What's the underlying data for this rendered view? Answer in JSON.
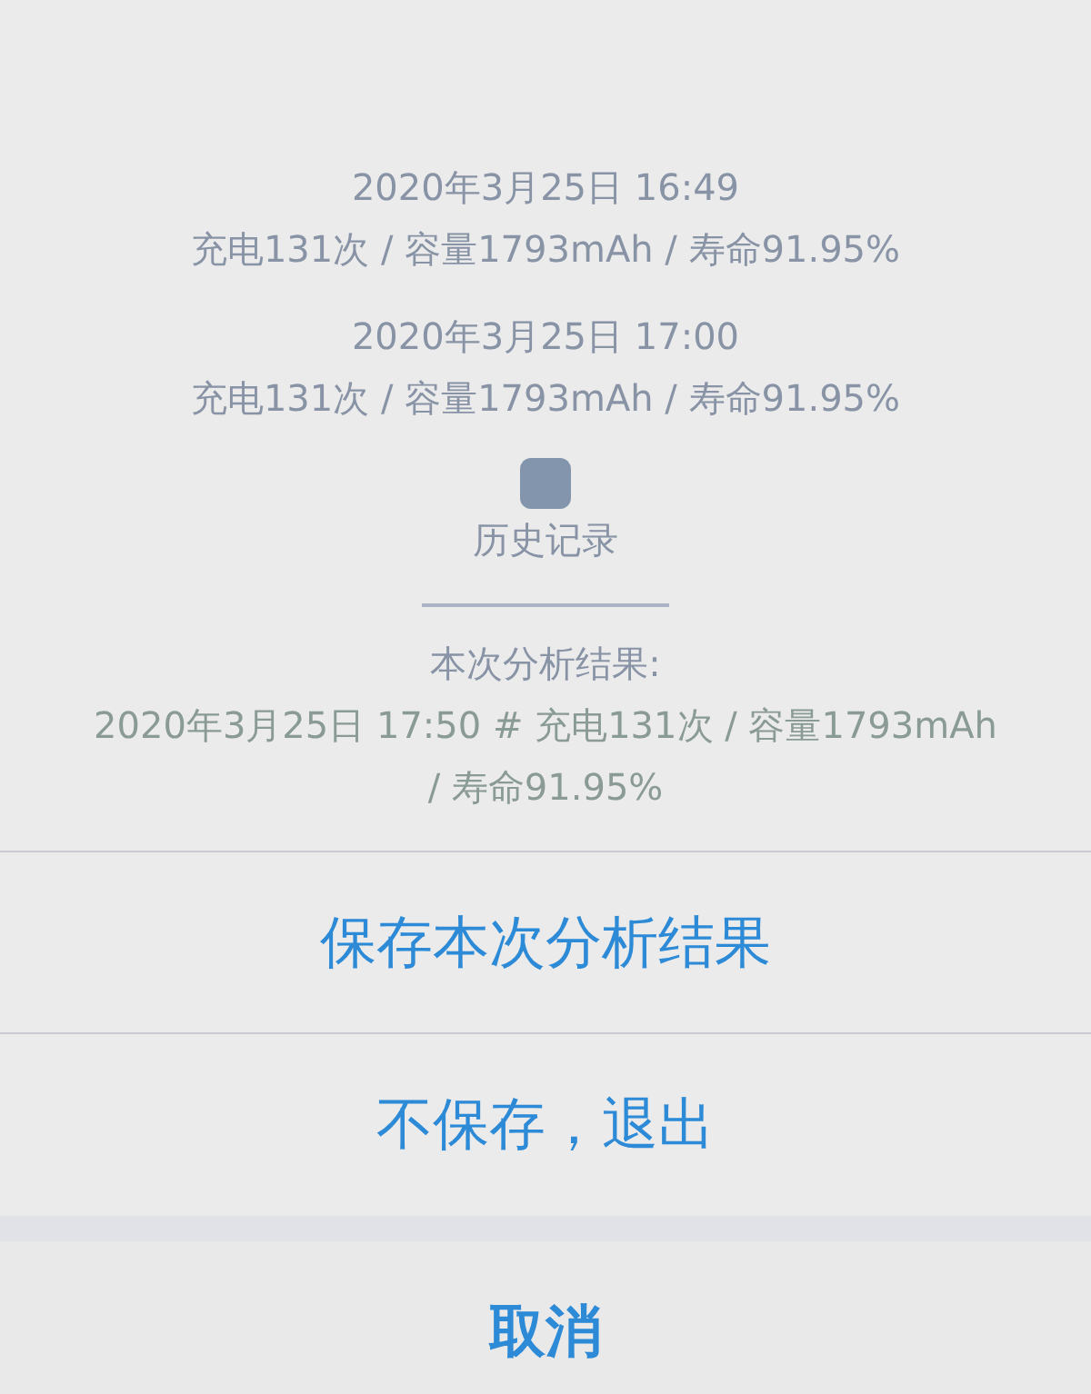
{
  "records": [
    {
      "datetime": "2020年3月25日 16:49",
      "summary": "充电131次 / 容量1793mAh / 寿命91.95%"
    },
    {
      "datetime": "2020年3月25日 17:00",
      "summary": "充电131次 / 容量1793mAh / 寿命91.95%"
    }
  ],
  "history_title": "历史记录",
  "result_label": "本次分析结果:",
  "result_text": "2020年3月25日 17:50 # 充电131次 / 容量1793mAh / 寿命91.95%",
  "actions": [
    {
      "label": "保存本次分析结果"
    },
    {
      "label": "不保存，退出"
    }
  ],
  "cancel": {
    "label": "取消"
  }
}
